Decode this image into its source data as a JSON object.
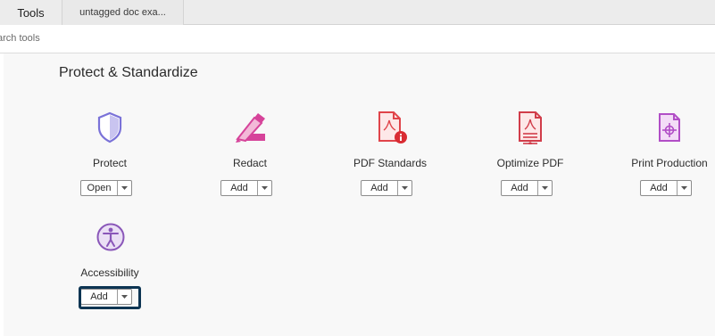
{
  "tabs": {
    "tools": "Tools",
    "document": "untagged doc exa..."
  },
  "search": {
    "placeholder": "arch tools"
  },
  "section": {
    "title": "Protect & Standardize"
  },
  "tools": [
    {
      "name": "Protect",
      "button": "Open",
      "icon": "shield-icon"
    },
    {
      "name": "Redact",
      "button": "Add",
      "icon": "redact-marker-icon"
    },
    {
      "name": "PDF Standards",
      "button": "Add",
      "icon": "pdf-standards-icon"
    },
    {
      "name": "Optimize PDF",
      "button": "Add",
      "icon": "optimize-pdf-icon"
    },
    {
      "name": "Print Production",
      "button": "Add",
      "icon": "print-production-icon"
    },
    {
      "name": "Accessibility",
      "button": "Add",
      "icon": "accessibility-icon"
    }
  ],
  "colors": {
    "protect": "#7a72d8",
    "redact": "#d6439a",
    "pdf_standards": "#e0444a",
    "optimize": "#d13d4a",
    "print_production": "#b14ec6",
    "accessibility": "#8a57b9",
    "focus_ring": "#0d3553"
  }
}
